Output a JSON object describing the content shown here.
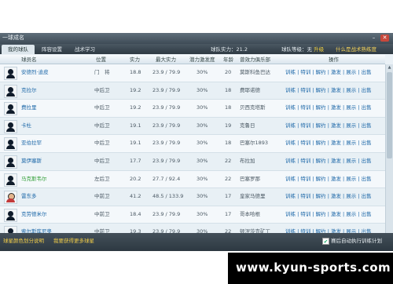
{
  "window": {
    "title": "一球成名",
    "min_glyph": "–",
    "close_glyph": "✕"
  },
  "tabs": [
    {
      "label": "我的球队"
    },
    {
      "label": "阵容设置"
    },
    {
      "label": "战术学习"
    }
  ],
  "status": {
    "team_strength": "球队实力：21.2",
    "team_level_prefix": "球队等级：无",
    "team_level_action": "升级",
    "best_tactic_link": "什么是战术熟练度"
  },
  "columns": [
    "球员名",
    "位置",
    "实力",
    "最大实力",
    "潜力激发度",
    "年龄",
    "曾效力俱乐部",
    "操作"
  ],
  "players": [
    {
      "name": "安德烈·迪皮",
      "position": "门　将",
      "strength": "18.8",
      "max": "23.9 / 79.9",
      "activation": "30%",
      "age": "20",
      "club": "莫斯科鱼巴达",
      "ops": "训练 | 特训 | 解约 | 激发 | 展示 | 出售",
      "avatar": "silhouette",
      "name_color": "normal"
    },
    {
      "name": "克拉尔",
      "position": "中后卫",
      "strength": "19.2",
      "max": "23.9 / 79.9",
      "activation": "30%",
      "age": "18",
      "club": "费耶诺德",
      "ops": "训练 | 特训 | 解约 | 激发 | 展示 | 出售",
      "avatar": "silhouette",
      "name_color": "normal"
    },
    {
      "name": "费拉里",
      "position": "中后卫",
      "strength": "19.2",
      "max": "23.9 / 79.9",
      "activation": "30%",
      "age": "18",
      "club": "贝西克塔斯",
      "ops": "训练 | 特训 | 解约 | 激发 | 展示 | 出售",
      "avatar": "silhouette",
      "name_color": "normal"
    },
    {
      "name": "卡杜",
      "position": "中后卫",
      "strength": "19.1",
      "max": "23.9 / 79.9",
      "activation": "30%",
      "age": "19",
      "club": "克鲁日",
      "ops": "训练 | 特训 | 解约 | 激发 | 展示 | 出售",
      "avatar": "silhouette",
      "name_color": "normal"
    },
    {
      "name": "亚伯拉罕",
      "position": "中后卫",
      "strength": "19.1",
      "max": "23.9 / 79.9",
      "activation": "30%",
      "age": "18",
      "club": "巴塞尔1893",
      "ops": "训练 | 特训 | 解约 | 激发 | 展示 | 出售",
      "avatar": "silhouette",
      "name_color": "normal"
    },
    {
      "name": "莫伊塞斯",
      "position": "中后卫",
      "strength": "17.7",
      "max": "23.9 / 79.9",
      "activation": "30%",
      "age": "22",
      "club": "布拉加",
      "ops": "训练 | 特训 | 解约 | 激发 | 展示 | 出售",
      "avatar": "silhouette",
      "name_color": "normal"
    },
    {
      "name": "马克斯韦尔",
      "position": "左后卫",
      "strength": "20.2",
      "max": "27.7 / 92.4",
      "activation": "30%",
      "age": "22",
      "club": "巴塞罗那",
      "ops": "训练 | 特训 | 解约 | 激发 | 展示 | 出售",
      "avatar": "silhouette",
      "name_color": "green"
    },
    {
      "name": "雷东多",
      "position": "中前卫",
      "strength": "41.2",
      "max": "48.5 / 133.9",
      "activation": "30%",
      "age": "17",
      "club": "皇家马德里",
      "ops": "训练 | 特训 | 解约 | 激发 | 展示 | 出售",
      "avatar": "photo",
      "name_color": "normal"
    },
    {
      "name": "克劳德米尔",
      "position": "中前卫",
      "strength": "18.4",
      "max": "23.9 / 79.9",
      "activation": "30%",
      "age": "17",
      "club": "哥本哈根",
      "ops": "训练 | 特训 | 解约 | 激发 | 展示 | 出售",
      "avatar": "silhouette",
      "name_color": "normal"
    },
    {
      "name": "索尔斯库尼奥",
      "position": "中前卫",
      "strength": "19.3",
      "max": "23.9 / 79.9",
      "activation": "30%",
      "age": "22",
      "club": "顿涅茨克矿工",
      "ops": "训练 | 特训 | 解约 | 激发 | 展示 | 出售",
      "avatar": "silhouette",
      "name_color": "normal"
    }
  ],
  "footer": {
    "legend_link": "球星颜色划分说明",
    "more_link": "我要获得更多球星",
    "checkbox_mark": "✔",
    "auto_train_label": "赛后自动执行训练计划"
  },
  "watermark": "www.kyun-sports.com",
  "colors": {
    "titlebar": "#3e4b56",
    "link_blue": "#1c67a8",
    "green_player": "#2f9e35",
    "footer_link": "#f3ce48"
  }
}
